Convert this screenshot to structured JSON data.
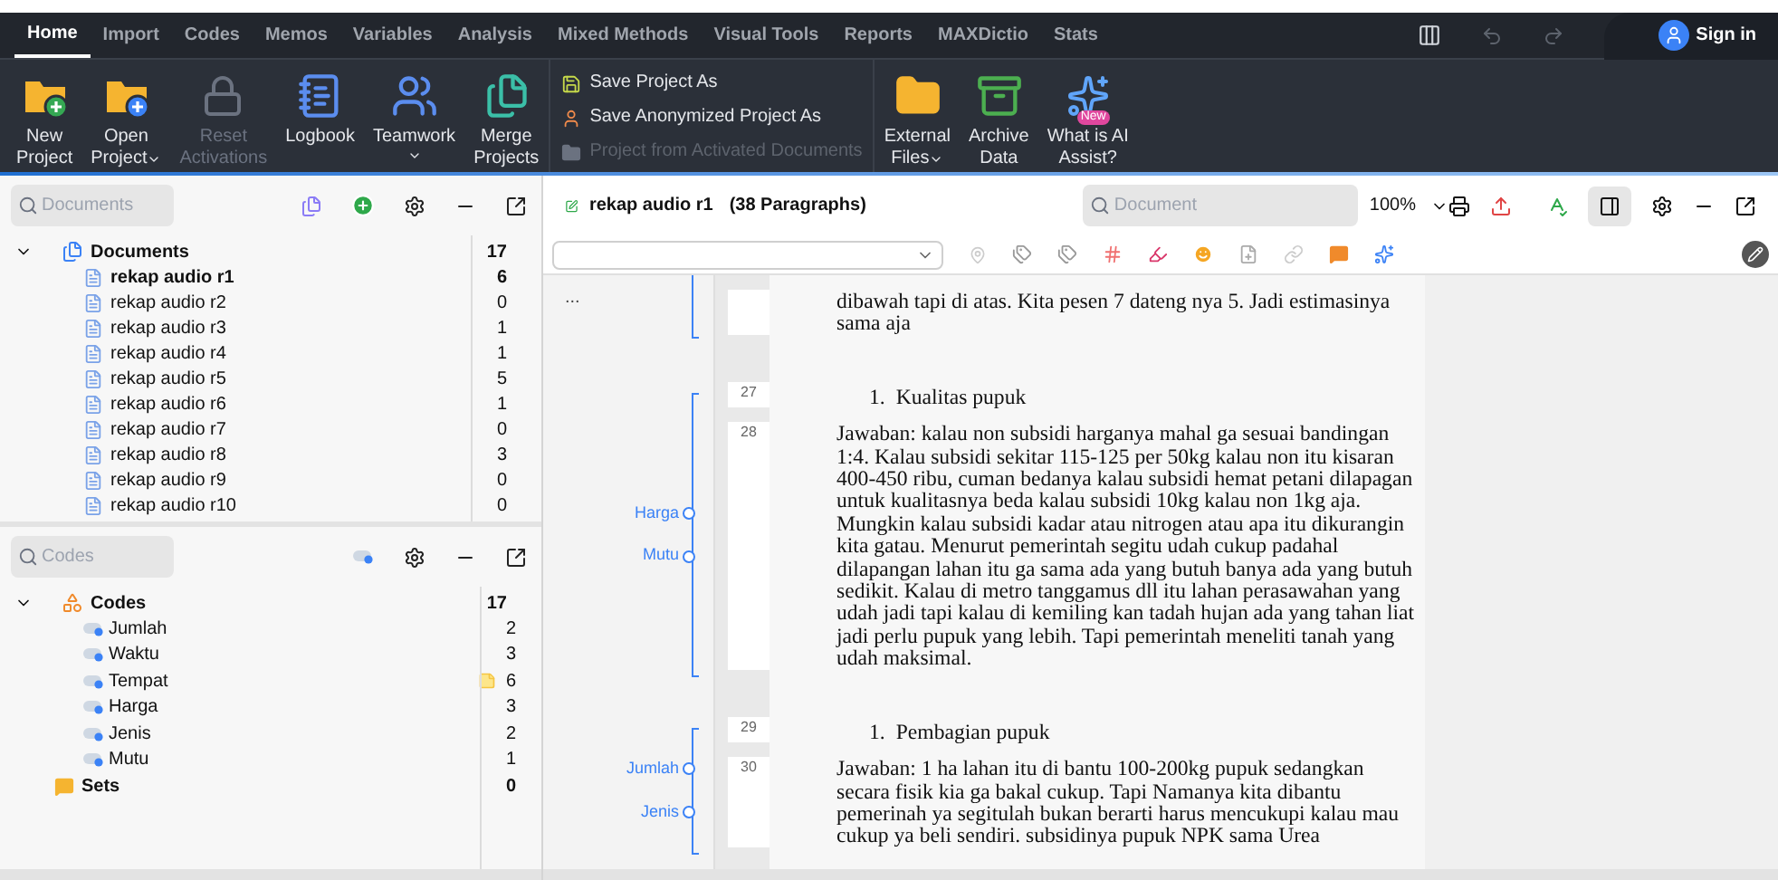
{
  "menu_tabs": [
    {
      "label": "Home",
      "selected": true
    },
    {
      "label": "Import",
      "selected": false
    },
    {
      "label": "Codes",
      "selected": false
    },
    {
      "label": "Memos",
      "selected": false
    },
    {
      "label": "Variables",
      "selected": false
    },
    {
      "label": "Analysis",
      "selected": false
    },
    {
      "label": "Mixed Methods",
      "selected": false
    },
    {
      "label": "Visual Tools",
      "selected": false
    },
    {
      "label": "Reports",
      "selected": false
    },
    {
      "label": "MAXDictio",
      "selected": false
    },
    {
      "label": "Stats",
      "selected": false
    }
  ],
  "sign_in": "Sign in",
  "ribbon": [
    {
      "kind": "large",
      "lines": [
        "New",
        "Project"
      ],
      "disabled": false,
      "dropdown": false
    },
    {
      "kind": "large",
      "lines": [
        "Open",
        "Project"
      ],
      "disabled": false,
      "dropdown": true
    },
    {
      "kind": "large",
      "lines": [
        "Reset",
        "Activations"
      ],
      "disabled": true,
      "dropdown": false
    },
    {
      "kind": "large",
      "lines": [
        "Logbook"
      ],
      "disabled": false,
      "dropdown": false
    },
    {
      "kind": "large",
      "lines": [
        "Teamwork"
      ],
      "disabled": false,
      "dropdown": true
    },
    {
      "kind": "large",
      "lines": [
        "Merge",
        "Projects"
      ],
      "disabled": false,
      "dropdown": false
    },
    {
      "kind": "stack",
      "items": [
        {
          "label": "Save Project As",
          "disabled": false
        },
        {
          "label": "Save Anonymized Project As",
          "disabled": false
        },
        {
          "label": "Project from Activated Documents",
          "disabled": true
        }
      ]
    },
    {
      "kind": "large",
      "lines": [
        "External",
        "Files"
      ],
      "disabled": false,
      "dropdown": true
    },
    {
      "kind": "large",
      "lines": [
        "Archive",
        "Data"
      ],
      "disabled": false,
      "dropdown": false
    },
    {
      "kind": "large",
      "lines": [
        "What is AI",
        "Assist?"
      ],
      "disabled": false,
      "dropdown": false,
      "badge": "New"
    }
  ],
  "documents_panel": {
    "search": {
      "placeholder": "Documents"
    },
    "root": {
      "label": "Documents",
      "count": "17",
      "expanded": true
    },
    "children": [
      {
        "label": "rekap audio r1",
        "count": "6",
        "active": true
      },
      {
        "label": "rekap audio r2",
        "count": "0",
        "active": false
      },
      {
        "label": "rekap audio r3",
        "count": "1",
        "active": false
      },
      {
        "label": "rekap audio r4",
        "count": "1",
        "active": false
      },
      {
        "label": "rekap audio r5",
        "count": "5",
        "active": false
      },
      {
        "label": "rekap audio r6",
        "count": "1",
        "active": false
      },
      {
        "label": "rekap audio r7",
        "count": "0",
        "active": false
      },
      {
        "label": "rekap audio r8",
        "count": "3",
        "active": false
      },
      {
        "label": "rekap audio r9",
        "count": "0",
        "active": false
      },
      {
        "label": "rekap audio r10",
        "count": "0",
        "active": false
      }
    ]
  },
  "codes_panel": {
    "search": {
      "placeholder": "Codes"
    },
    "root": {
      "label": "Codes",
      "count": "17",
      "expanded": true
    },
    "children": [
      {
        "label": "Jumlah",
        "count": "2",
        "memo": false
      },
      {
        "label": "Waktu",
        "count": "3",
        "memo": false
      },
      {
        "label": "Tempat",
        "count": "6",
        "memo": true
      },
      {
        "label": "Harga",
        "count": "3",
        "memo": false
      },
      {
        "label": "Jenis",
        "count": "2",
        "memo": false
      },
      {
        "label": "Mutu",
        "count": "1",
        "memo": false
      }
    ],
    "sets": {
      "label": "Sets",
      "count": "0"
    }
  },
  "document": {
    "title": "rekap audio r1",
    "subtitle": "(38 Paragraphs)",
    "search": {
      "placeholder": "Document"
    },
    "zoom": "100%",
    "segments": [
      {
        "more": "...",
        "paragraphs": [
          {
            "kind": "text",
            "text": "dibawah tapi di atas. Kita pesen 7 dateng nya 5. Jadi estimasinya sama aja"
          }
        ]
      },
      {
        "codes": [
          "Harga",
          "Mutu"
        ],
        "paragraphs": [
          {
            "kind": "list",
            "number": "27",
            "marker": "1.",
            "text": "Kualitas pupuk"
          },
          {
            "kind": "text",
            "number": "28",
            "text": "Jawaban: kalau non subsidi harganya mahal ga sesuai bandingan 1:4. Kalau subsidi sekitar 115-125 per 50kg kalau non itu kisaran 400-450 ribu, cuman bedanya kalau subsidi hemat petani dilapagan untuk kualitasnya beda kalau subsidi 10kg kalau non 1kg aja. Mungkin kalau subsidi kadar atau nitrogen atau apa itu dikurangin kita gatau. Menurut pemerintah segitu udah cukup padahal dilapangan lahan itu ga sama ada yang butuh banya ada yang butuh sedikit. Kalau di metro tanggamus dll itu lahan perasawahan yang udah jadi tapi kalau di kemiling kan tadah hujan ada yang tahan liat jadi perlu pupuk yang lebih. Tapi pemerintah meneliti tanah yang udah maksimal."
          }
        ]
      },
      {
        "codes": [
          "Jumlah",
          "Jenis"
        ],
        "paragraphs": [
          {
            "kind": "list",
            "number": "29",
            "marker": "1.",
            "text": "Pembagian pupuk"
          },
          {
            "kind": "text",
            "number": "30",
            "text": "Jawaban: 1 ha lahan itu di bantu 100-200kg pupuk sedangkan secara fisik kia ga bakal cukup. Tapi Namanya kita dibantu pemerinah ya segitulah bukan berarti harus mencukupi kalau mau cukup ya beli sendiri. subsidinya pupuk NPK sama Urea"
          }
        ]
      }
    ]
  }
}
